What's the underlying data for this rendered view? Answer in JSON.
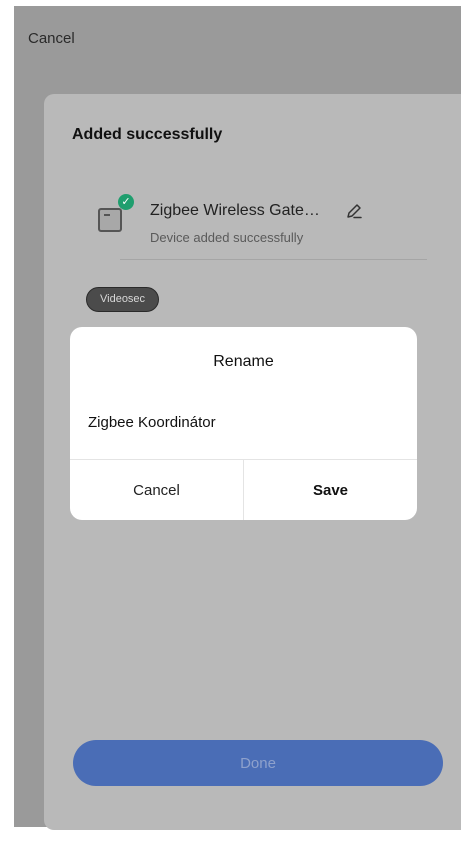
{
  "top_bar": {
    "cancel_label": "Cancel"
  },
  "sheet": {
    "title": "Added successfully",
    "device": {
      "name": "Zigbee Wireless Gate…",
      "status": "Device added successfully",
      "icon": "gateway-device-icon",
      "badge_icon": "check-badge-icon"
    },
    "room_chip": "Videosec",
    "done_label": "Done"
  },
  "dialog": {
    "title": "Rename",
    "input_value": "Zigbee Koordinátor",
    "cancel_label": "Cancel",
    "save_label": "Save"
  },
  "colors": {
    "accent": "#4a6db6",
    "success": "#1f9e6e",
    "caret": "#f0a020"
  }
}
